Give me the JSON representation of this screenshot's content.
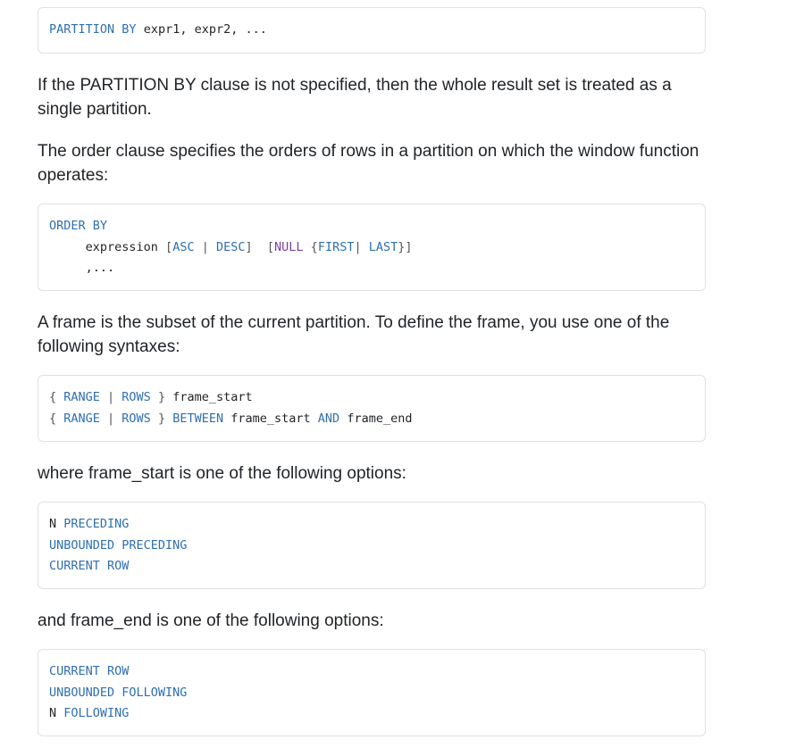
{
  "blocks": {
    "partition": {
      "lines": [
        [
          {
            "t": "PARTITION",
            "c": "kw"
          },
          {
            "t": " ",
            "c": "ph"
          },
          {
            "t": "BY",
            "c": "kw"
          },
          {
            "t": " expr1, expr2, ...",
            "c": "ph"
          }
        ]
      ]
    },
    "order": {
      "lines": [
        [
          {
            "t": "ORDER",
            "c": "kw"
          },
          {
            "t": " ",
            "c": "ph"
          },
          {
            "t": "BY",
            "c": "kw"
          }
        ],
        [
          {
            "t": "     expression ",
            "c": "ph"
          },
          {
            "t": "[",
            "c": "pn"
          },
          {
            "t": "ASC",
            "c": "kw"
          },
          {
            "t": " | ",
            "c": "pn"
          },
          {
            "t": "DESC",
            "c": "kw"
          },
          {
            "t": "]",
            "c": "pn"
          },
          {
            "t": "  ",
            "c": "ph"
          },
          {
            "t": "[",
            "c": "pn"
          },
          {
            "t": "NULL",
            "c": "lit"
          },
          {
            "t": " {",
            "c": "pn"
          },
          {
            "t": "FIRST",
            "c": "kw"
          },
          {
            "t": "| ",
            "c": "pn"
          },
          {
            "t": "LAST",
            "c": "kw"
          },
          {
            "t": "}]",
            "c": "pn"
          }
        ],
        [
          {
            "t": "     ,...",
            "c": "ph"
          }
        ]
      ]
    },
    "frame": {
      "lines": [
        [
          {
            "t": "{ ",
            "c": "pn"
          },
          {
            "t": "RANGE",
            "c": "kw"
          },
          {
            "t": " | ",
            "c": "pn"
          },
          {
            "t": "ROWS",
            "c": "kw"
          },
          {
            "t": " }",
            "c": "pn"
          },
          {
            "t": " frame_start",
            "c": "ph"
          }
        ],
        [
          {
            "t": "{ ",
            "c": "pn"
          },
          {
            "t": "RANGE",
            "c": "kw"
          },
          {
            "t": " | ",
            "c": "pn"
          },
          {
            "t": "ROWS",
            "c": "kw"
          },
          {
            "t": " }",
            "c": "pn"
          },
          {
            "t": " ",
            "c": "ph"
          },
          {
            "t": "BETWEEN",
            "c": "kw"
          },
          {
            "t": " frame_start ",
            "c": "ph"
          },
          {
            "t": "AND",
            "c": "kw"
          },
          {
            "t": " frame_end",
            "c": "ph"
          }
        ]
      ]
    },
    "start": {
      "lines": [
        [
          {
            "t": "N ",
            "c": "ph"
          },
          {
            "t": "PRECEDING",
            "c": "kw"
          }
        ],
        [
          {
            "t": "UNBOUNDED PRECEDING",
            "c": "kw"
          }
        ],
        [
          {
            "t": "CURRENT ROW",
            "c": "kw"
          }
        ]
      ]
    },
    "end": {
      "lines": [
        [
          {
            "t": "CURRENT ROW",
            "c": "kw"
          }
        ],
        [
          {
            "t": "UNBOUNDED FOLLOWING",
            "c": "kw"
          }
        ],
        [
          {
            "t": "N ",
            "c": "ph"
          },
          {
            "t": "FOLLOWING",
            "c": "kw"
          }
        ]
      ]
    }
  },
  "paragraphs": {
    "partition_note": "If the PARTITION BY clause is not specified, then the whole result set is treated as a single partition.",
    "order_note": "The order clause specifies the orders of rows in a partition on which the window function operates:",
    "frame_note": "A frame is the subset of the current partition. To define the frame, you use one of the following syntaxes:",
    "start_note": "where frame_start is one of the following options:",
    "end_note": "and frame_end is one of the following options:"
  }
}
